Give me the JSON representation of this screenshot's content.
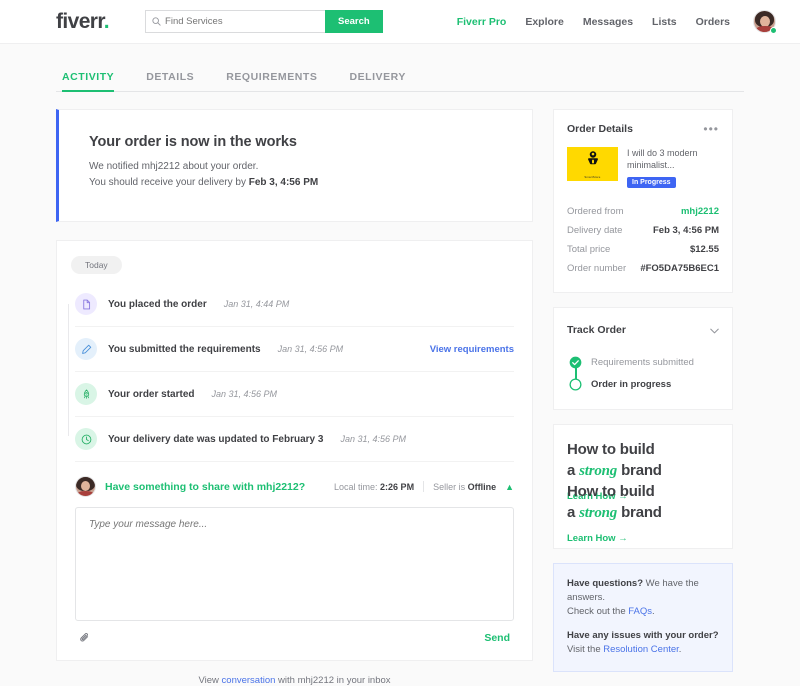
{
  "header": {
    "logo_text": "fiverr",
    "logo_dot": ".",
    "search": {
      "placeholder": "Find Services",
      "value": "",
      "button_label": "Search"
    },
    "nav": [
      {
        "label": "Fiverr Pro",
        "accent": true
      },
      {
        "label": "Explore",
        "accent": false
      },
      {
        "label": "Messages",
        "accent": false
      },
      {
        "label": "Lists",
        "accent": false
      },
      {
        "label": "Orders",
        "accent": false
      }
    ]
  },
  "tabs": [
    {
      "label": "ACTIVITY",
      "active": true
    },
    {
      "label": "DETAILS",
      "active": false
    },
    {
      "label": "REQUIREMENTS",
      "active": false
    },
    {
      "label": "DELIVERY",
      "active": false
    }
  ],
  "status": {
    "title": "Your order is now in the works",
    "line1": "We notified mhj2212 about your order.",
    "line2_prefix": "You should receive your delivery by ",
    "line2_date": "Feb 3, 4:56 PM",
    "accent_color": "#3e65f3"
  },
  "activity": {
    "day_badge": "Today",
    "events": [
      {
        "icon": "document-icon",
        "text": "You placed the order",
        "time": "Jan 31, 4:44 PM",
        "link": ""
      },
      {
        "icon": "pencil-icon",
        "text": "You submitted the requirements",
        "time": "Jan 31, 4:56 PM",
        "link": "View requirements"
      },
      {
        "icon": "rocket-icon",
        "text": "Your order started",
        "time": "Jan 31, 4:56 PM",
        "link": ""
      },
      {
        "icon": "clock-icon",
        "text": "Your delivery date was updated to February 3",
        "time": "Jan 31, 4:56 PM",
        "link": ""
      }
    ]
  },
  "message": {
    "prompt": "Have something to share with mhj2212?",
    "local_time_label": "Local time: ",
    "local_time_value": "2:26 PM",
    "seller_status_label": "Seller is ",
    "seller_status_value": "Offline",
    "textarea_placeholder": "Type your message here...",
    "textarea_value": "",
    "send_label": "Send"
  },
  "footer": {
    "prefix": "View ",
    "link": "conversation",
    "suffix": " with mhj2212 in your inbox"
  },
  "order_details": {
    "title": "Order Details",
    "menu_icon": "•••",
    "gig_title": "I will do 3 modern minimalist...",
    "gig_badge": "In Progress",
    "gig_thumb_caption": "SmartStore",
    "gig_thumb_color": "#ffd900",
    "rows": [
      {
        "label": "Ordered from",
        "value": "mhj2212",
        "green": true
      },
      {
        "label": "Delivery date",
        "value": "Feb 3, 4:56 PM",
        "green": false
      },
      {
        "label": "Total price",
        "value": "$12.55",
        "green": false
      },
      {
        "label": "Order number",
        "value": "#FO5DA75B6EC1",
        "green": false
      }
    ]
  },
  "track_order": {
    "title": "Track Order",
    "steps": [
      {
        "label": "Requirements submitted",
        "complete": true
      },
      {
        "label": "Order in progress",
        "complete": false
      }
    ]
  },
  "promo": {
    "line1": "How to build",
    "line2_a": "a ",
    "line2_em": "strong",
    "line2_b": " brand",
    "link": "Learn How →"
  },
  "help": {
    "q1_bold": "Have questions?",
    "q1_rest": " We have the answers.",
    "q1_line2_prefix": "Check out the ",
    "q1_line2_link": "FAQs",
    "q1_line2_suffix": ".",
    "q2_bold": "Have any issues with your order?",
    "q2_line2_prefix": "Visit the ",
    "q2_line2_link": "Resolution Center",
    "q2_line2_suffix": "."
  }
}
